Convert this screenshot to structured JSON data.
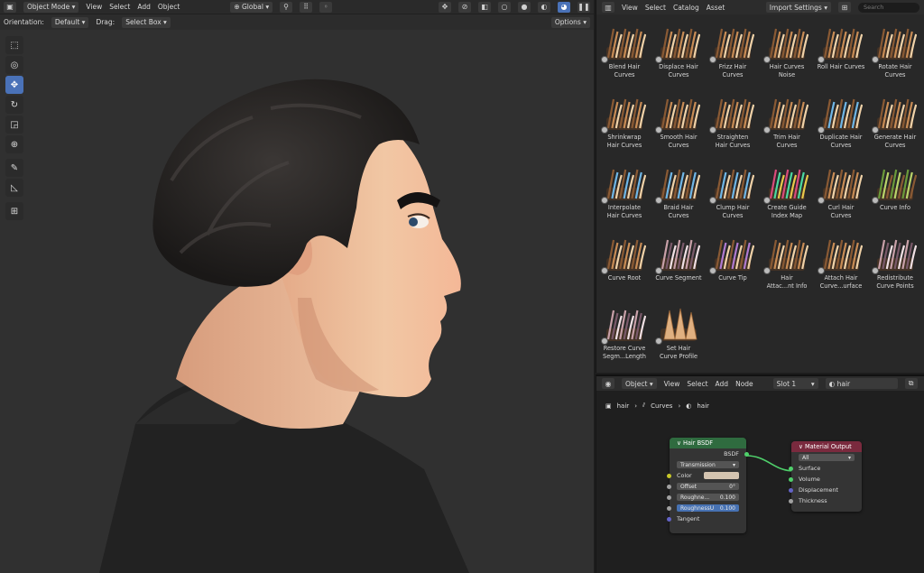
{
  "viewport_header": {
    "editor_icon": "cube-icon",
    "mode": "Object Mode",
    "menus": [
      "View",
      "Select",
      "Add",
      "Object"
    ],
    "transform": "Global"
  },
  "tool_header": {
    "orientation_label": "Orientation:",
    "orientation_value": "Default",
    "drag_label": "Drag:",
    "drag_value": "Select Box",
    "options": "Options"
  },
  "toolbar": [
    "select-box-icon",
    "cursor-icon",
    "move-icon",
    "rotate-icon",
    "scale-icon",
    "transform-icon",
    "annotate-icon",
    "measure-icon",
    "add-cube-icon"
  ],
  "asset_browser": {
    "menus": [
      "View",
      "Select",
      "Catalog",
      "Asset"
    ],
    "import_settings": "Import Settings",
    "search_placeholder": "Search",
    "items": [
      {
        "label": "Blend Hair\nCurves",
        "style": "brown"
      },
      {
        "label": "Displace Hair\nCurves",
        "style": "brown"
      },
      {
        "label": "Frizz Hair\nCurves",
        "style": "brown"
      },
      {
        "label": "Hair Curves\nNoise",
        "style": "brown"
      },
      {
        "label": "Roll Hair Curves",
        "style": "brown"
      },
      {
        "label": "Rotate Hair\nCurves",
        "style": "brown"
      },
      {
        "label": "Shrinkwrap\nHair Curves",
        "style": "brown"
      },
      {
        "label": "Smooth Hair\nCurves",
        "style": "brown"
      },
      {
        "label": "Straighten\nHair Curves",
        "style": "brown"
      },
      {
        "label": "Trim Hair\nCurves",
        "style": "brown"
      },
      {
        "label": "Duplicate Hair\nCurves",
        "style": "blue"
      },
      {
        "label": "Generate Hair\nCurves",
        "style": "brown"
      },
      {
        "label": "Interpolate\nHair Curves",
        "style": "blue"
      },
      {
        "label": "Braid Hair\nCurves",
        "style": "blue"
      },
      {
        "label": "Clump Hair\nCurves",
        "style": "blue"
      },
      {
        "label": "Create Guide\nIndex Map",
        "style": "multi"
      },
      {
        "label": "Curl Hair\nCurves",
        "style": "brown"
      },
      {
        "label": "Curve Info",
        "style": "green"
      },
      {
        "label": "Curve Root",
        "style": "brown"
      },
      {
        "label": "Curve Segment",
        "style": "pink"
      },
      {
        "label": "Curve Tip",
        "style": "purple"
      },
      {
        "label": "Hair\nAttac...nt Info",
        "style": "brown"
      },
      {
        "label": "Attach Hair\nCurve...urface",
        "style": "brown"
      },
      {
        "label": "Redistribute\nCurve Points",
        "style": "pink"
      },
      {
        "label": "Restore Curve\nSegm...Length",
        "style": "pink"
      },
      {
        "label": "Set Hair\nCurve Profile",
        "style": "spikes"
      }
    ]
  },
  "node_editor": {
    "object_mode": "Object",
    "menus": [
      "View",
      "Select",
      "Add",
      "Node"
    ],
    "slot": "Slot 1",
    "material": "hair",
    "breadcrumb": [
      "hair",
      "Curves",
      "hair"
    ],
    "hair_bsdf": {
      "title": "Hair BSDF",
      "output": "BSDF",
      "mode": "Transmission",
      "color_label": "Color",
      "color_value": "#d4c4b0",
      "offset_label": "Offset",
      "offset_value": "0°",
      "roughness_u_label": "RoughnessU",
      "roughness_u_value": "0.100",
      "roughness_v_label": "Roughne...",
      "roughness_v_value": "0.100",
      "tangent_label": "Tangent"
    },
    "material_output": {
      "title": "Material Output",
      "target": "All",
      "inputs": [
        "Surface",
        "Volume",
        "Displacement",
        "Thickness"
      ]
    }
  },
  "colors": {
    "accent": "#4a72b8",
    "shader_header": "#2f6b3f",
    "output_header": "#7a2a3e",
    "link": "#4fd06b"
  }
}
